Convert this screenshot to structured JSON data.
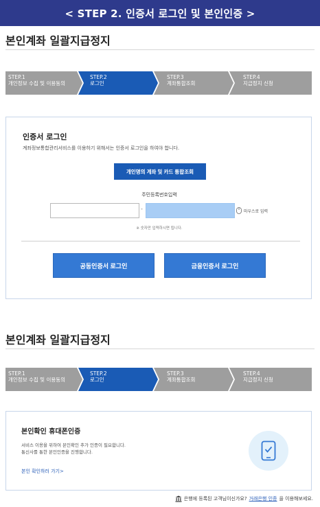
{
  "banner": {
    "title": "< STEP 2. 인증서 로그인 및 본인인증 >"
  },
  "section1": {
    "title": "본인계좌 일괄지급정지"
  },
  "section2": {
    "title": "본인계좌 일괄지급정지"
  },
  "steps": [
    {
      "num": "STEP.1",
      "label": "개인정보 수집 및 이용동의",
      "active": false
    },
    {
      "num": "STEP.2",
      "label": "로그인",
      "active": true
    },
    {
      "num": "STEP.3",
      "label": "계좌통합조회",
      "active": false
    },
    {
      "num": "STEP.4",
      "label": "지급정지 신청",
      "active": false
    }
  ],
  "colors": {
    "banner": "#2e3a8c",
    "step_active": "#1a5bb5",
    "step_inactive": "#9e9e9e",
    "button_blue": "#3479d4",
    "rrn_back": "#a8cdf5"
  },
  "cert": {
    "title": "인증서 로그인",
    "desc": "계좌정보통합관리서비스를 이용하기 위해서는 인증서 로그인을 하여야 합니다.",
    "integrated_button": "개인명의 계좌 및 카드 통합조회",
    "rrn_label": "주민등록번호입력",
    "rrn_dash": "-",
    "mouse_input": "마우스로 입력",
    "rrn_note": "※ 숫자만 입력하시면 됩니다.",
    "btn_public": "공동인증서 로그인",
    "btn_finance": "금융인증서 로그인"
  },
  "phone": {
    "title": "본인확인 휴대폰인증",
    "desc_line1": "서비스 이용을 위하여 본인확인 추가 인증이 필요합니다.",
    "desc_line2": "통신사를 통한 본인인증을 진행합니다.",
    "link": "본인 확인하러 가기>",
    "icon": "mobile-check-icon"
  },
  "bottom": {
    "text_before": "은행에 등록된 고객님이신가요?",
    "link": "거래은행 인증",
    "text_after": "을 이용해보세요.",
    "icon": "bank-icon"
  }
}
